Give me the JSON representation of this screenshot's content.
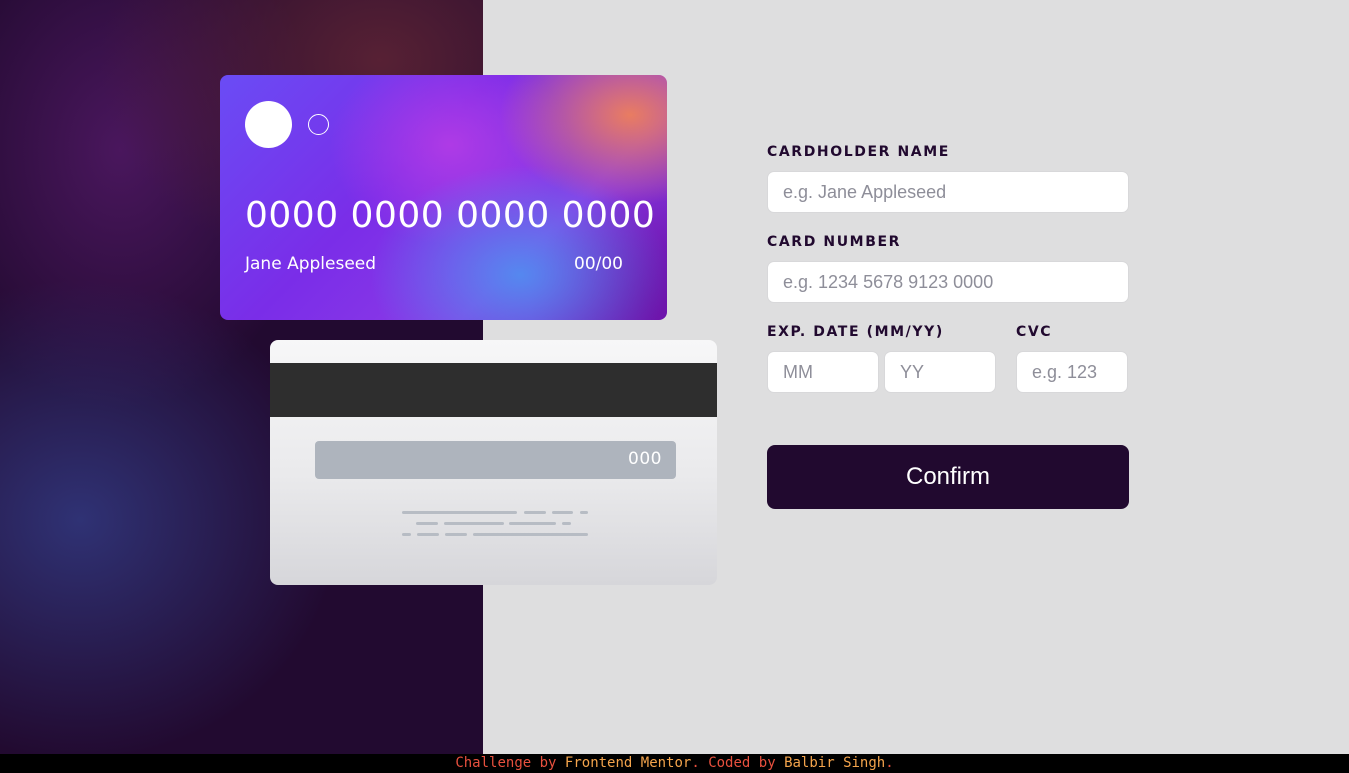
{
  "card_front": {
    "number": "0000 0000 0000 0000",
    "name": "Jane Appleseed",
    "expiry": "00/00"
  },
  "card_back": {
    "cvc": "000"
  },
  "form": {
    "cardholder_label": "CARDHOLDER NAME",
    "cardholder_placeholder": "e.g. Jane Appleseed",
    "number_label": "CARD NUMBER",
    "number_placeholder": "e.g. 1234 5678 9123 0000",
    "exp_label": "EXP. DATE (MM/YY)",
    "month_placeholder": "MM",
    "year_placeholder": "YY",
    "cvc_label": "CVC",
    "cvc_placeholder": "e.g. 123",
    "confirm_label": "Confirm"
  },
  "footer": {
    "text_1": "Challenge by ",
    "link_1": "Frontend Mentor",
    "text_2": ". Coded by ",
    "link_2": "Balbir Singh",
    "text_3": "."
  },
  "colors": {
    "dark_violet": "#21092f",
    "page_background": "#dededf",
    "footer_muted": "#e8503e",
    "footer_link": "#f4a44c"
  }
}
